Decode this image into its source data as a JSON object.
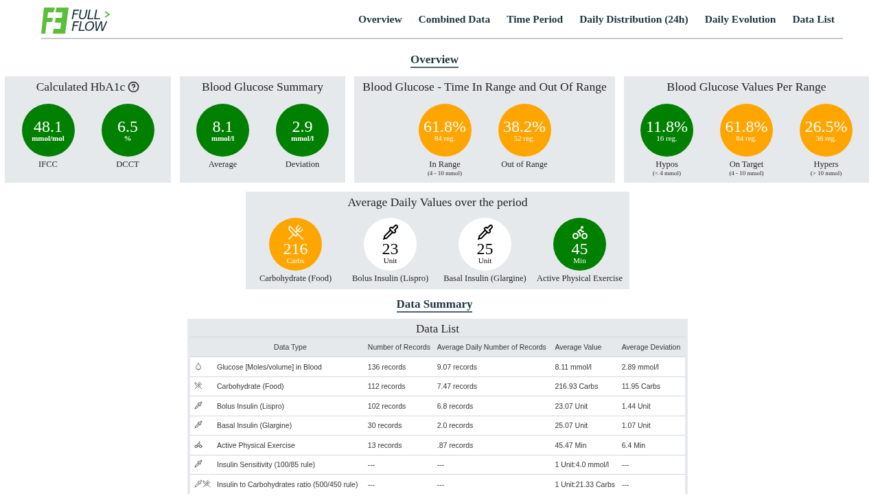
{
  "logo": {
    "line1": "FULL",
    "line2": "FLOW"
  },
  "nav": [
    {
      "label": "Overview"
    },
    {
      "label": "Combined Data"
    },
    {
      "label": "Time Period"
    },
    {
      "label": "Daily Distribution (24h)"
    },
    {
      "label": "Daily Evolution"
    },
    {
      "label": "Data List"
    }
  ],
  "overview_title": "Overview",
  "cards": [
    {
      "title": "Calculated HbA1c",
      "help_icon": true,
      "stats": [
        {
          "value": "48.1",
          "unit": "mmol/mol",
          "label": "IFCC",
          "color": "#008000"
        },
        {
          "value": "6.5",
          "unit": "%",
          "label": "DCCT",
          "color": "#008000"
        }
      ]
    },
    {
      "title": "Blood Glucose Summary",
      "help_icon": false,
      "stats": [
        {
          "value": "8.1",
          "unit": "mmol/l",
          "label": "Average",
          "color": "#008000"
        },
        {
          "value": "2.9",
          "unit": "mmol/l",
          "label": "Deviation",
          "color": "#008000"
        }
      ]
    },
    {
      "title": "Blood Glucose - Time In Range and Out Of Range",
      "help_icon": false,
      "stats": [
        {
          "value": "61.8%",
          "unit": "84 reg.",
          "label": "In Range",
          "note": "(4 - 10 mmol)",
          "color": "#ffa500"
        },
        {
          "value": "38.2%",
          "unit": "52 reg.",
          "label": "Out of Range",
          "color": "#ffa500"
        }
      ]
    },
    {
      "title": "Blood Glucose Values Per Range",
      "help_icon": false,
      "stats": [
        {
          "value": "11.8%",
          "unit": "16 reg.",
          "label": "Hypos",
          "note": "(< 4 mmol)",
          "color": "#008000"
        },
        {
          "value": "61.8%",
          "unit": "84 reg.",
          "label": "On Target",
          "note": "(4 - 10 mmol)",
          "color": "#ffa500"
        },
        {
          "value": "26.5%",
          "unit": "36 reg.",
          "label": "Hypers",
          "note": "(> 10 mmol)",
          "color": "#ffa500"
        }
      ]
    }
  ],
  "daily": {
    "title": "Average Daily Values over the period",
    "stats": [
      {
        "kind": "food",
        "value": "216",
        "unit": "Carbs",
        "label": "Carbohydrate (Food)",
        "color": "#ffa500"
      },
      {
        "kind": "insulin",
        "value": "23",
        "unit": "Unit",
        "label": "Bolus Insulin (Lispro)",
        "color": "#ffffff"
      },
      {
        "kind": "insulin",
        "value": "25",
        "unit": "Unit",
        "label": "Basal Insulin (Glargine)",
        "color": "#ffffff"
      },
      {
        "kind": "exercise",
        "value": "45",
        "unit": "Min",
        "label": "Active Physical Exercise",
        "color": "#008000"
      }
    ]
  },
  "summary_title": "Data Summary",
  "table": {
    "title": "Data List",
    "columns": [
      "Data Type",
      "Number of Records",
      "Average Daily Number of Records",
      "Average Value",
      "Average Deviation"
    ],
    "rows": [
      {
        "kind": "glucose",
        "cells": [
          "Glucose [Moles/volume] in Blood",
          "136 records",
          "9.07 records",
          "8.11 mmol/l",
          "2.89 mmol/l"
        ]
      },
      {
        "kind": "food",
        "cells": [
          "Carbohydrate (Food)",
          "112 records",
          "7.47 records",
          "216.93 Carbs",
          "11.95 Carbs"
        ]
      },
      {
        "kind": "insulin",
        "cells": [
          "Bolus Insulin (Lispro)",
          "102 records",
          "6.8 records",
          "23.07 Unit",
          "1.44 Unit"
        ]
      },
      {
        "kind": "insulin",
        "cells": [
          "Basal Insulin (Glargine)",
          "30 records",
          "2.0 records",
          "25.07 Unit",
          "1.07 Unit"
        ]
      },
      {
        "kind": "exercise",
        "cells": [
          "Active Physical Exercise",
          "13 records",
          ".87 records",
          "45.47 Min",
          "6.4 Min"
        ]
      },
      {
        "kind": "insulin",
        "cells": [
          "Insulin Sensitivity (100/85 rule)",
          "---",
          "---",
          "1 Unit:4.0 mmol/l",
          "---"
        ]
      },
      {
        "kind": "ratio",
        "cells": [
          "Insulin to Carbohydrates ratio (500/450 rule)",
          "---",
          "---",
          "1 Unit:21.33 Carbs",
          "---"
        ]
      }
    ]
  }
}
